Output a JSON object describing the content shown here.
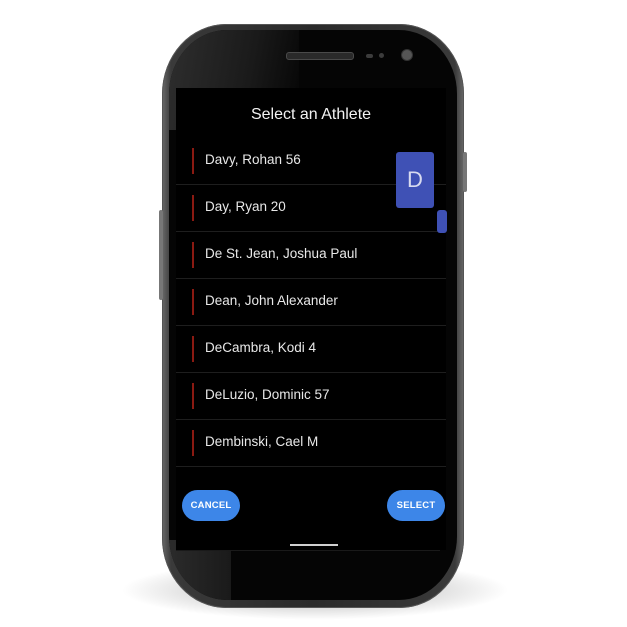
{
  "dialog": {
    "title": "Select an Athlete",
    "athletes": [
      {
        "name": "Davy, Rohan 56"
      },
      {
        "name": "Day, Ryan 20"
      },
      {
        "name": "De St. Jean, Joshua Paul"
      },
      {
        "name": "Dean, John Alexander"
      },
      {
        "name": "DeCambra, Kodi 4"
      },
      {
        "name": "DeLuzio, Dominic 57"
      },
      {
        "name": "Dembinski, Cael M"
      }
    ],
    "index_bubble_letter": "D",
    "cancel_label": "CANCEL",
    "select_label": "SELECT"
  },
  "colors": {
    "accent_bar": "#8b1a12",
    "index_bubble": "#3f51b5",
    "button": "#3d86e8",
    "background": "#000000"
  }
}
